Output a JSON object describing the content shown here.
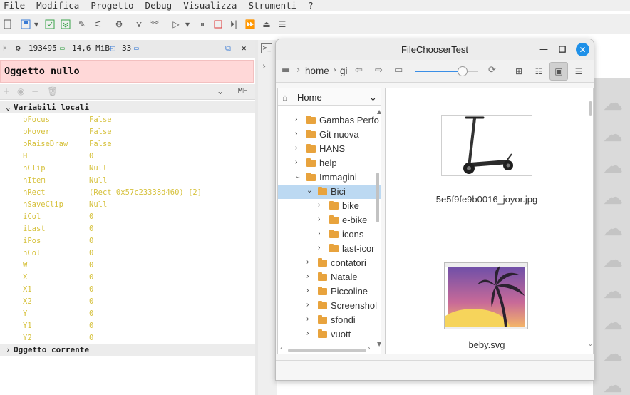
{
  "menubar": {
    "items": [
      "File",
      "Modifica",
      "Progetto",
      "Debug",
      "Visualizza",
      "Strumenti",
      "?"
    ]
  },
  "debug": {
    "header": {
      "process_id": "193495",
      "memory": "14,6 MiB",
      "count": "33"
    },
    "error": "Oggetto nullo",
    "toolbar_label": "ME",
    "locals_title": "Variabili locali",
    "current_object_title": "Oggetto corrente",
    "variables": [
      {
        "name": "bFocus",
        "value": "False"
      },
      {
        "name": "bHover",
        "value": "False"
      },
      {
        "name": "bRaiseDraw",
        "value": "False"
      },
      {
        "name": "H",
        "value": "0"
      },
      {
        "name": "hClip",
        "value": "Null"
      },
      {
        "name": "hItem",
        "value": "Null"
      },
      {
        "name": "hRect",
        "value": "(Rect 0x57c23338d460) [2]"
      },
      {
        "name": "hSaveClip",
        "value": "Null"
      },
      {
        "name": "iCol",
        "value": "0"
      },
      {
        "name": "iLast",
        "value": "0"
      },
      {
        "name": "iPos",
        "value": "0"
      },
      {
        "name": "nCol",
        "value": "0"
      },
      {
        "name": "W",
        "value": "0"
      },
      {
        "name": "X",
        "value": "0"
      },
      {
        "name": "X1",
        "value": "0"
      },
      {
        "name": "X2",
        "value": "0"
      },
      {
        "name": "Y",
        "value": "0"
      },
      {
        "name": "Y1",
        "value": "0"
      },
      {
        "name": "Y2",
        "value": "0"
      }
    ]
  },
  "dialog": {
    "title": "FileChooserTest",
    "breadcrumb": [
      "home",
      "gi"
    ],
    "zoom_level": 0.75,
    "tree_root": "Home",
    "tree": [
      {
        "label": "Gambas Perfo",
        "depth": 0,
        "expanded": false,
        "selected": false
      },
      {
        "label": "Git nuova",
        "depth": 0,
        "expanded": false,
        "selected": false
      },
      {
        "label": "HANS",
        "depth": 0,
        "expanded": false,
        "selected": false
      },
      {
        "label": "help",
        "depth": 0,
        "expanded": false,
        "selected": false
      },
      {
        "label": "Immagini",
        "depth": 0,
        "expanded": true,
        "selected": false
      },
      {
        "label": "Bici",
        "depth": 1,
        "expanded": true,
        "selected": true
      },
      {
        "label": "bike",
        "depth": 2,
        "expanded": false,
        "selected": false
      },
      {
        "label": "e-bike",
        "depth": 2,
        "expanded": false,
        "selected": false
      },
      {
        "label": "icons",
        "depth": 2,
        "expanded": false,
        "selected": false
      },
      {
        "label": "last-icor",
        "depth": 2,
        "expanded": false,
        "selected": false
      },
      {
        "label": "contatori",
        "depth": 1,
        "expanded": false,
        "selected": false
      },
      {
        "label": "Natale",
        "depth": 1,
        "expanded": false,
        "selected": false
      },
      {
        "label": "Piccoline",
        "depth": 1,
        "expanded": false,
        "selected": false
      },
      {
        "label": "Screenshol",
        "depth": 1,
        "expanded": false,
        "selected": false
      },
      {
        "label": "sfondi",
        "depth": 1,
        "expanded": false,
        "selected": false
      },
      {
        "label": "vuott",
        "depth": 1,
        "expanded": false,
        "selected": false
      }
    ],
    "files": [
      {
        "name": "5e5f9fe9b0016_joyor.jpg",
        "icon": "scooter-image"
      },
      {
        "name": "beby.svg",
        "icon": "palm-sunset-image"
      }
    ]
  },
  "colors": {
    "accent": "#1e90e8",
    "error_bg": "#ffd8d8",
    "variable_text": "#d6c13c",
    "folder": "#e8a33d",
    "selection": "#bcd9f2"
  }
}
